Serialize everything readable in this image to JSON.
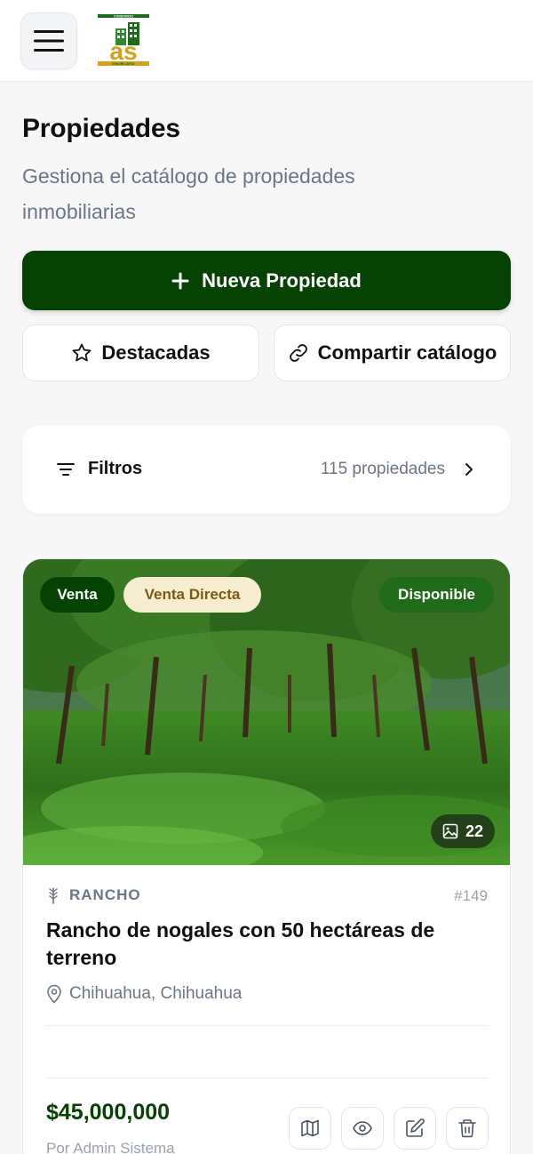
{
  "header": {
    "menu_icon": "hamburger-menu-icon",
    "logo_top_text": "CONSORCIO",
    "logo_letters": "as",
    "logo_bottom_text": "INMOBILIARIO"
  },
  "page": {
    "title": "Propiedades",
    "subtitle": "Gestiona el catálogo de propiedades inmobiliarias"
  },
  "actions": {
    "new_property": "Nueva Propiedad",
    "featured": "Destacadas",
    "share_catalog": "Compartir catálogo"
  },
  "filters": {
    "label": "Filtros",
    "count": "115 propiedades"
  },
  "property": {
    "badges": {
      "operation": "Venta",
      "sale_type": "Venta Directa",
      "status": "Disponible"
    },
    "photo_count": "22",
    "type": "RANCHO",
    "id": "#149",
    "title": "Rancho de nogales con 50 hectáreas de terreno",
    "location": "Chihuahua, Chihuahua",
    "price": "$45,000,000",
    "author": "Por Admin Sistema"
  },
  "colors": {
    "brand_green": "#064203",
    "status_green": "#1f6b1a",
    "badge_cream": "#f6ecd0",
    "badge_cream_text": "#7b5b12",
    "logo_gold": "#d4a21a",
    "logo_green": "#1c6a1c"
  },
  "icons": {
    "new_property": "plus-icon",
    "featured": "star-icon",
    "share": "link-icon",
    "filters": "filter-icon",
    "filters_chevron": "chevron-right-icon",
    "photos": "image-icon",
    "type": "wheat-icon",
    "location": "map-pin-icon",
    "card_actions": [
      "map-icon",
      "eye-icon",
      "edit-icon",
      "trash-icon"
    ]
  }
}
